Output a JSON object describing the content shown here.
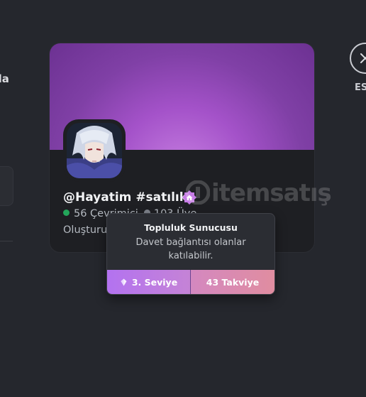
{
  "sidebar_fragment": {
    "text": "da"
  },
  "close": {
    "label": "ESC"
  },
  "server": {
    "name": "@Hayatim #satılık",
    "online_text": "56 Çevrimiçi",
    "members_text": "103 Üye",
    "created_text": "Oluşturuldu"
  },
  "watermark": {
    "text": "itemsatış"
  },
  "tooltip": {
    "title": "Topluluk Sunucusu",
    "description": "Davet bağlantısı olanlar katılabilir.",
    "level_label": "3. Seviye",
    "boost_label": "43 Takviye"
  },
  "colors": {
    "banner": "#8040a6",
    "online": "#23a55a",
    "level_gradient_start": "#b372f0",
    "boost_gradient_end": "#e08da0",
    "badge": "#c77de6"
  },
  "icons": {
    "close": "close-icon",
    "boost_badge": "boost-house-icon",
    "gem": "boost-gem-icon"
  }
}
